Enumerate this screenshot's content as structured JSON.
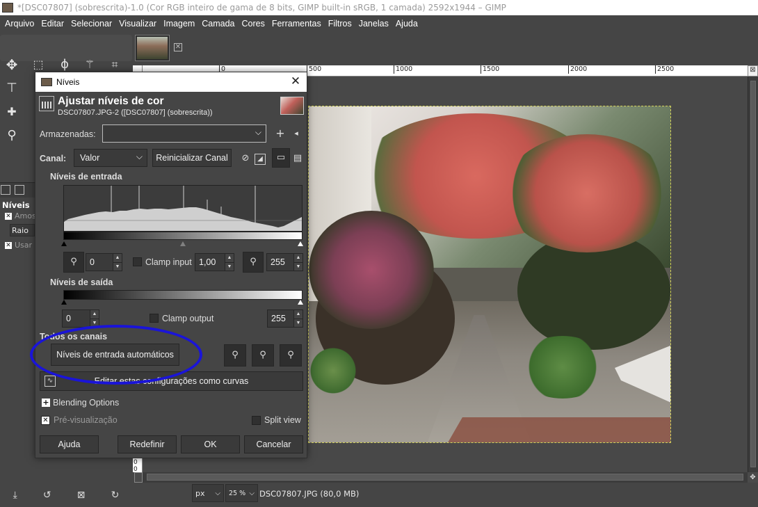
{
  "window": {
    "title": "*[DSC07807] (sobrescrita)-1.0 (Cor RGB inteiro de gama de 8 bits, GIMP built-in sRGB, 1 camada) 2592x1944 – GIMP"
  },
  "menu": [
    "Arquivo",
    "Editar",
    "Selecionar",
    "Visualizar",
    "Imagem",
    "Camada",
    "Cores",
    "Ferramentas",
    "Filtros",
    "Janelas",
    "Ajuda"
  ],
  "tool_options": {
    "title": "Níveis",
    "sample_label": "Amos",
    "radius_label": "Raio",
    "use_label": "Usar a"
  },
  "ruler": {
    "h_labels": [
      "0",
      "500",
      "1000",
      "1500",
      "2000",
      "2500"
    ],
    "v_labels": [
      "0",
      "0"
    ],
    "corner_symbol": "⊠"
  },
  "status": {
    "unit": "px",
    "zoom": "25 %",
    "file_info": "DSC07807.JPG (80,0 MB)"
  },
  "dialog": {
    "window_title": "Níveis",
    "title": "Ajustar níveis de cor",
    "subtitle": "DSC07807.JPG-2 ([DSC07807] (sobrescrita))",
    "presets_label": "Armazenadas:",
    "presets_value": "",
    "channel_label": "Canal:",
    "channel_value": "Valor",
    "reset_channel": "Reinicializar Canal",
    "input_levels_title": "Níveis de entrada",
    "input_low": "0",
    "clamp_input_label": "Clamp input",
    "gamma": "1,00",
    "input_high": "255",
    "output_levels_title": "Níveis de saída",
    "output_low": "0",
    "clamp_output_label": "Clamp output",
    "output_high": "255",
    "all_channels_title": "Todos os canais",
    "auto_input_levels": "Níveis de entrada automáticos",
    "edit_as_curves": "Editar estas configurações como curvas",
    "blending_options": "Blending Options",
    "preview_label": "Pré-visualização",
    "split_view_label": "Split view",
    "buttons": {
      "help": "Ajuda",
      "reset": "Redefinir",
      "ok": "OK",
      "cancel": "Cancelar"
    }
  },
  "colors": {
    "highlight_ellipse": "#1a14d8",
    "background": "#454545"
  }
}
